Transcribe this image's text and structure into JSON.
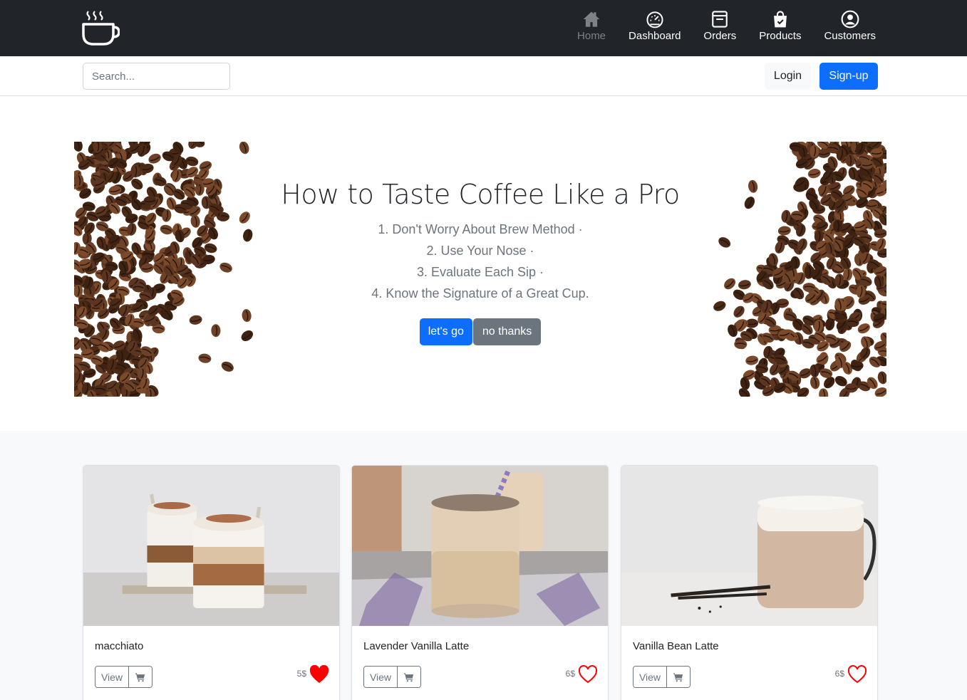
{
  "nav": {
    "logo_icon": "coffee-cup-icon",
    "items": [
      {
        "label": "Home",
        "icon": "house-icon",
        "active": false
      },
      {
        "label": "Dashboard",
        "icon": "speedometer-icon"
      },
      {
        "label": "Orders",
        "icon": "table-icon"
      },
      {
        "label": "Products",
        "icon": "bag-check-icon"
      },
      {
        "label": "Customers",
        "icon": "person-circle-icon"
      }
    ]
  },
  "search": {
    "placeholder": "Search..."
  },
  "auth": {
    "login": "Login",
    "signup": "Sign-up"
  },
  "hero": {
    "title": "How to Taste Coffee Like a Pro",
    "steps": [
      "1. Don't Worry About Brew Method ·",
      "2. Use Your Nose ·",
      "3. Evaluate Each Sip ·",
      "4. Know the Signature of a Great Cup."
    ],
    "primary_button": "let's go",
    "secondary_button": "no thanks"
  },
  "products": [
    {
      "name": "macchiato",
      "price": "5$",
      "favorited": true,
      "view_label": "View"
    },
    {
      "name": "Lavender Vanilla Latte",
      "price": "6$",
      "favorited": false,
      "view_label": "View"
    },
    {
      "name": "Vanilla Bean Latte",
      "price": "6$",
      "favorited": false,
      "view_label": "View"
    }
  ],
  "colors": {
    "primary": "#0d6efd",
    "dark": "#212529",
    "secondary": "#6c757d",
    "heart": "#ff0000"
  }
}
